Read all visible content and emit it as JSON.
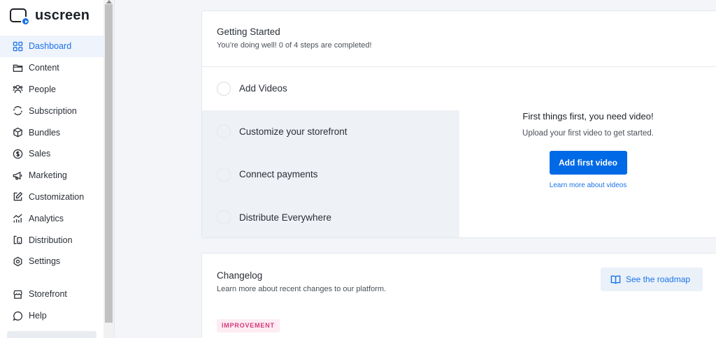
{
  "brand": {
    "name": "uscreen",
    "accent": "#1a73e8"
  },
  "sidebar": {
    "items": [
      {
        "label": "Dashboard",
        "icon": "dashboard-icon",
        "active": true
      },
      {
        "label": "Content",
        "icon": "folder-icon"
      },
      {
        "label": "People",
        "icon": "people-icon"
      },
      {
        "label": "Subscription",
        "icon": "subscription-icon"
      },
      {
        "label": "Bundles",
        "icon": "box-icon"
      },
      {
        "label": "Sales",
        "icon": "dollar-icon"
      },
      {
        "label": "Marketing",
        "icon": "megaphone-icon"
      },
      {
        "label": "Customization",
        "icon": "edit-icon"
      },
      {
        "label": "Analytics",
        "icon": "analytics-icon"
      },
      {
        "label": "Distribution",
        "icon": "devices-icon"
      },
      {
        "label": "Settings",
        "icon": "settings-icon"
      }
    ],
    "bottom_items": [
      {
        "label": "Storefront",
        "icon": "storefront-icon"
      },
      {
        "label": "Help",
        "icon": "help-icon"
      }
    ]
  },
  "getting_started": {
    "title": "Getting Started",
    "subtitle": "You’re doing well! 0 of 4 steps are completed!",
    "steps": [
      {
        "label": "Add Videos"
      },
      {
        "label": "Customize your storefront"
      },
      {
        "label": "Connect payments"
      },
      {
        "label": "Distribute Everywhere"
      }
    ],
    "detail": {
      "title": "First things first, you need video!",
      "text": "Upload your first video to get started.",
      "button": "Add first video",
      "link": "Learn more about videos"
    }
  },
  "changelog": {
    "title": "Changelog",
    "subtitle": "Learn more about recent changes to our platform.",
    "roadmap_button": "See the roadmap",
    "badge": "IMPROVEMENT"
  }
}
